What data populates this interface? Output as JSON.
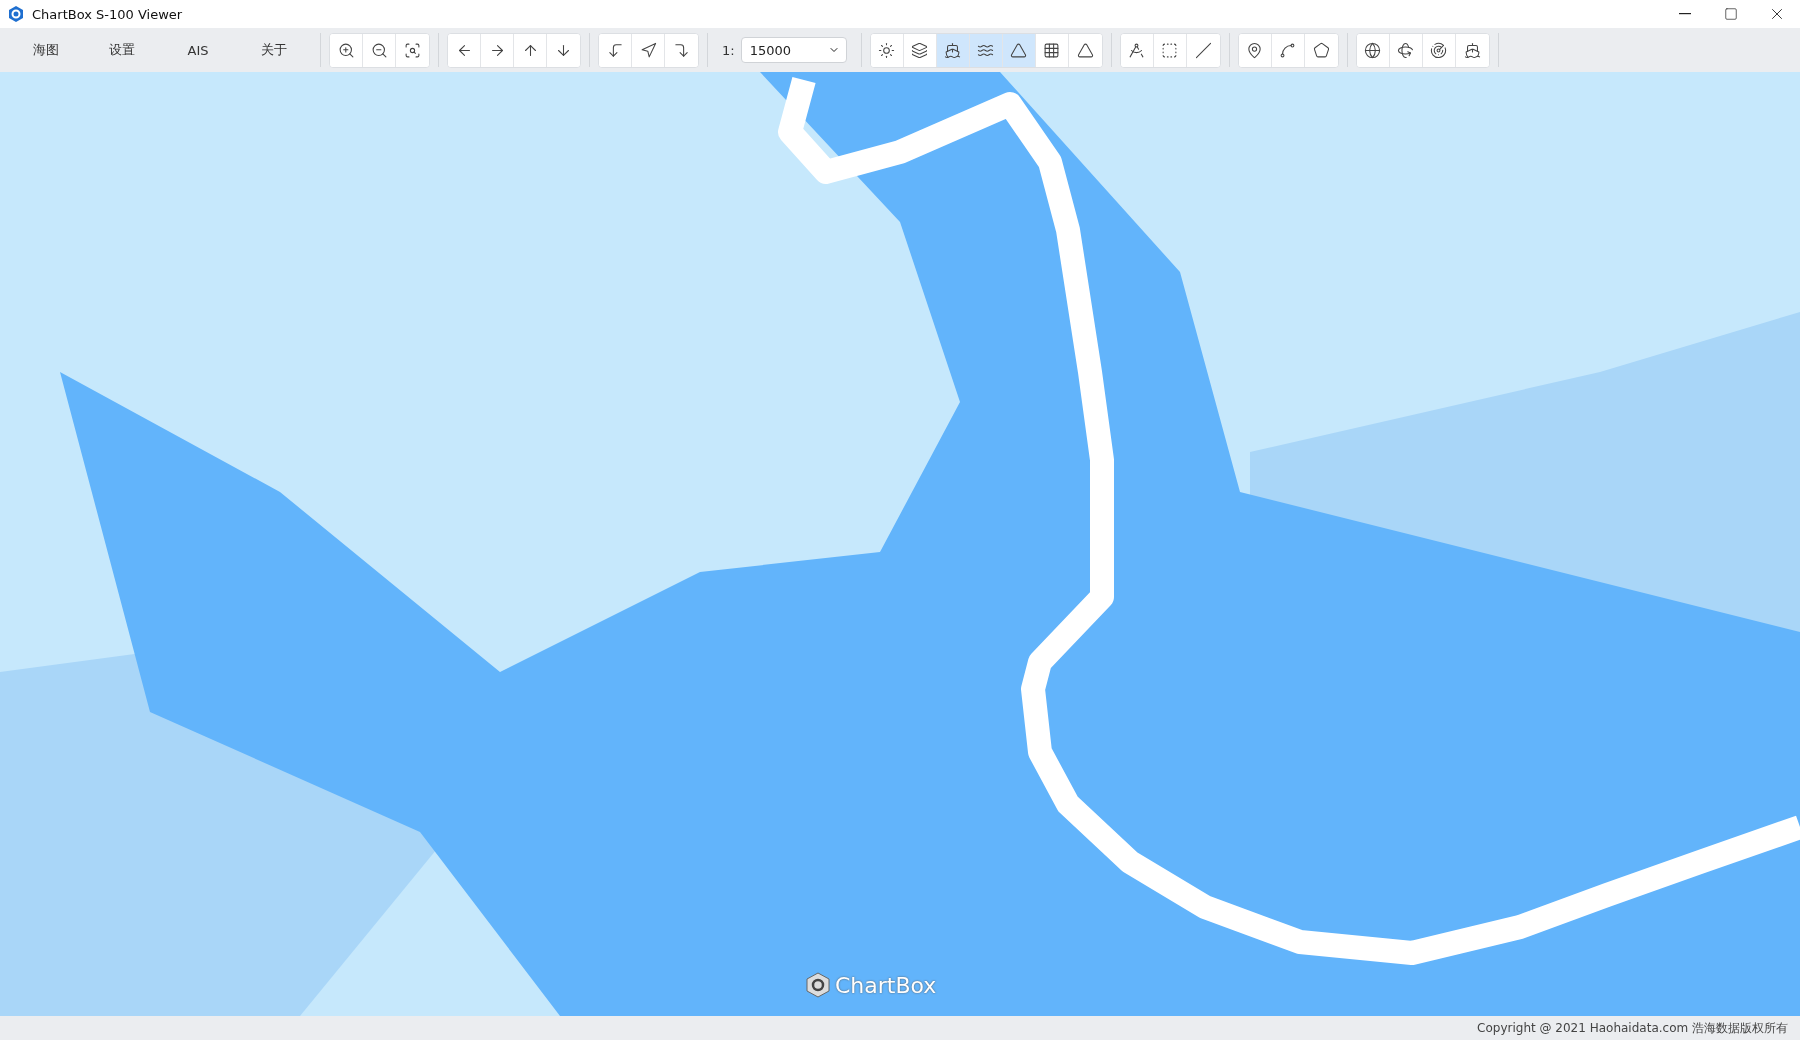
{
  "window": {
    "title": "ChartBox S-100 Viewer"
  },
  "menu": [
    {
      "label": "海图"
    },
    {
      "label": "设置"
    },
    {
      "label": "AIS"
    },
    {
      "label": "关于"
    }
  ],
  "toolbar": {
    "groups": [
      {
        "buttons": [
          {
            "kind": "zoom-in",
            "pressed": false
          },
          {
            "kind": "zoom-out",
            "pressed": false
          },
          {
            "kind": "zoom-fit",
            "pressed": false
          }
        ]
      },
      {
        "buttons": [
          {
            "kind": "left",
            "pressed": false
          },
          {
            "kind": "right",
            "pressed": false
          },
          {
            "kind": "up",
            "pressed": false
          },
          {
            "kind": "down",
            "pressed": false
          }
        ]
      },
      {
        "buttons": [
          {
            "kind": "rotate-left",
            "pressed": false
          },
          {
            "kind": "north",
            "pressed": false
          },
          {
            "kind": "rotate-right",
            "pressed": false
          }
        ]
      },
      {
        "kind": "scale",
        "prefix": "1:",
        "value": "15000"
      },
      {
        "buttons": [
          {
            "kind": "brightness",
            "pressed": false
          },
          {
            "kind": "layers",
            "pressed": false
          },
          {
            "kind": "soundings",
            "pressed": true
          },
          {
            "kind": "contours",
            "pressed": true
          },
          {
            "kind": "lighthouse",
            "pressed": true
          },
          {
            "kind": "grid",
            "pressed": false
          },
          {
            "kind": "buoy",
            "pressed": false
          }
        ]
      },
      {
        "buttons": [
          {
            "kind": "compass",
            "pressed": false
          },
          {
            "kind": "area",
            "pressed": false
          },
          {
            "kind": "angle",
            "pressed": false
          }
        ]
      },
      {
        "buttons": [
          {
            "kind": "pin",
            "pressed": false
          },
          {
            "kind": "line",
            "pressed": false
          },
          {
            "kind": "polygon",
            "pressed": false
          }
        ]
      },
      {
        "buttons": [
          {
            "kind": "globe",
            "pressed": false
          },
          {
            "kind": "rotate-3d",
            "pressed": false
          },
          {
            "kind": "radar",
            "pressed": false
          },
          {
            "kind": "ship",
            "pressed": false
          }
        ]
      }
    ]
  },
  "map": {
    "logo": "ChartBox"
  },
  "status_bar": {
    "copyright": "Copyright @ 2021 Haohaidata.com 浩海数据版权所有"
  }
}
